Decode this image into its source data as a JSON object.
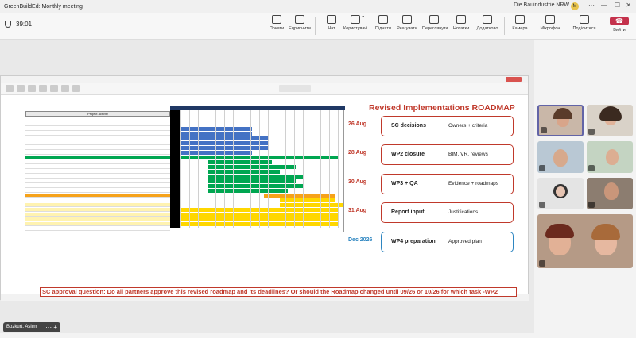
{
  "window": {
    "title": "GreenBuildEd: Monthly meeting",
    "org": "Die Bauindustrie NRW",
    "avatar_initial": "M"
  },
  "meeting": {
    "timer": "39:01"
  },
  "toolbar": [
    {
      "label": "Почати",
      "icon": "start-icon"
    },
    {
      "label": "Ецрипнити",
      "icon": "share-icon"
    },
    {
      "label": "Чат",
      "icon": "chat-icon"
    },
    {
      "label": "Користувачі",
      "icon": "people-icon",
      "badge": "7"
    },
    {
      "label": "Підняти",
      "icon": "raise-hand-icon"
    },
    {
      "label": "Реагувати",
      "icon": "react-icon"
    },
    {
      "label": "Переглянути",
      "icon": "view-icon"
    },
    {
      "label": "Нотатки",
      "icon": "notes-icon"
    },
    {
      "label": "Додатково",
      "icon": "more-icon"
    },
    {
      "label": "Камера",
      "icon": "camera-icon"
    },
    {
      "label": "Мікрофон",
      "icon": "mic-icon"
    },
    {
      "label": "Поділитися",
      "icon": "share-screen-icon"
    }
  ],
  "leave": {
    "label": "Вийти"
  },
  "slide": {
    "title": "Revised Implementations ROADMAP",
    "steps": [
      {
        "date": "26 Aug",
        "title": "SC decisions",
        "detail": "Owners + criteria"
      },
      {
        "date": "28 Aug",
        "title": "WP2 closure",
        "detail": "BIM, VR, reviews"
      },
      {
        "date": "30 Aug",
        "title": "WP3 + QA",
        "detail": "Evidence + roadmaps"
      },
      {
        "date": "31 Aug",
        "title": "Report input",
        "detail": "Justifications"
      },
      {
        "date": "Dec 2026",
        "title": "WP4 preparation",
        "detail": "Approved plan"
      }
    ],
    "question": "SC approval question: Do all partners approve this revised roadmap and its deadlines? Or should the Roadmap changed until 09/26 or 10/26 for  which task -WP2",
    "gantt_caption": "Project activity"
  },
  "self_view": {
    "name": "Bozkurt, Aslım"
  }
}
